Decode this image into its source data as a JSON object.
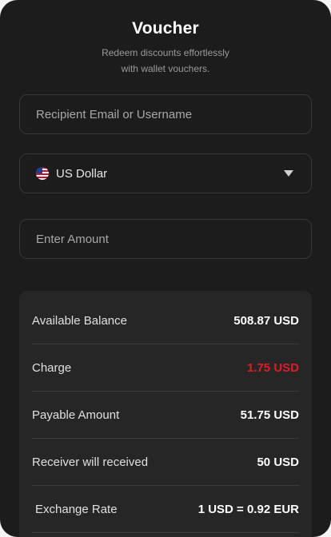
{
  "header": {
    "title": "Voucher",
    "subtitle_line1": "Redeem discounts effortlessly",
    "subtitle_line2": "with wallet vouchers."
  },
  "form": {
    "recipient_placeholder": "Recipient Email or Username",
    "recipient_value": "",
    "currency": {
      "selected": "US Dollar",
      "flag_icon": "us-flag-icon"
    },
    "amount_placeholder": "Enter Amount",
    "amount_value": ""
  },
  "summary": {
    "rows": [
      {
        "label": "Available Balance",
        "value": "508.87 USD"
      },
      {
        "label": "Charge",
        "value": "1.75 USD"
      },
      {
        "label": "Payable Amount",
        "value": "51.75 USD"
      },
      {
        "label": "Receiver will received",
        "value": "50 USD"
      },
      {
        "label": "Exchange Rate",
        "value": "1 USD = 0.92 EUR"
      }
    ]
  },
  "colors": {
    "background": "#1c1c1c",
    "panel": "#262626",
    "charge": "#e01b24",
    "text": "#ffffff"
  }
}
